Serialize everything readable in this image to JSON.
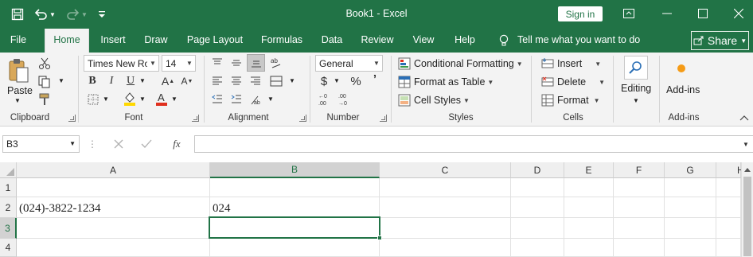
{
  "window": {
    "title": "Book1  -  Excel",
    "sign_in": "Sign in"
  },
  "tabs": [
    "File",
    "Home",
    "Insert",
    "Draw",
    "Page Layout",
    "Formulas",
    "Data",
    "Review",
    "View",
    "Help"
  ],
  "active_tab": "Home",
  "tell_me": "Tell me what you want to do",
  "share": "Share",
  "ribbon": {
    "clipboard": {
      "paste": "Paste",
      "label": "Clipboard"
    },
    "font": {
      "name": "Times New Roman",
      "size": "14",
      "bold": "B",
      "italic": "I",
      "underline": "U",
      "label": "Font"
    },
    "alignment": {
      "label": "Alignment"
    },
    "number": {
      "format": "General",
      "currency": "$",
      "percent": "%",
      "comma": "’",
      "label": "Number"
    },
    "styles": {
      "conditional": "Conditional Formatting",
      "table": "Format as Table",
      "cell_styles": "Cell Styles",
      "label": "Styles"
    },
    "cells": {
      "insert": "Insert",
      "delete": "Delete",
      "format": "Format",
      "label": "Cells"
    },
    "editing": {
      "label": "Editing"
    },
    "addins": {
      "button": "Add-ins",
      "label": "Add-ins"
    }
  },
  "formula_bar": {
    "name_box": "B3",
    "fx": "fx",
    "value": ""
  },
  "sheet": {
    "columns": [
      "A",
      "B",
      "C",
      "D",
      "E",
      "F",
      "G",
      "H"
    ],
    "selected_column": "B",
    "rows": [
      "1",
      "2",
      "3",
      "4"
    ],
    "selected_row": "3",
    "cells": {
      "A2": "(024)-3822-1234",
      "B2": "024"
    }
  },
  "colors": {
    "accent": "#217346",
    "ribbon": "#f3f3f3",
    "orange_addin": "#f59b16",
    "red_font": "#e0301e",
    "yellow_fill": "#ffd800"
  }
}
